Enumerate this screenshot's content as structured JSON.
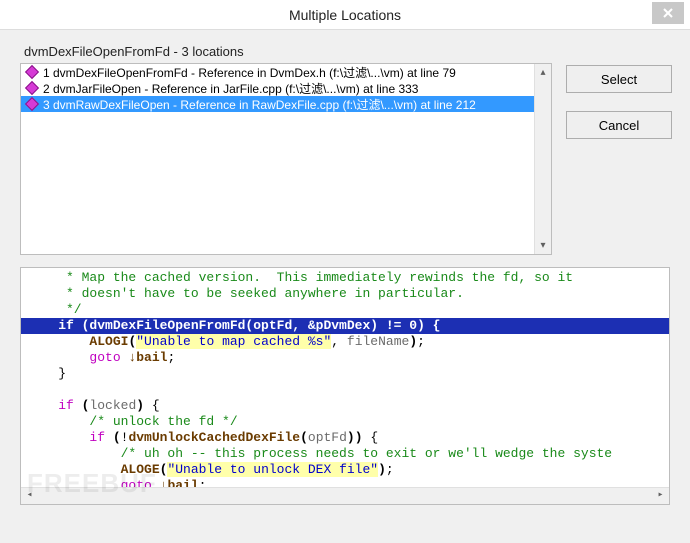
{
  "window": {
    "title": "Multiple Locations",
    "close_glyph": "×"
  },
  "heading": "dvmDexFileOpenFromFd - 3 locations",
  "list": {
    "items": [
      {
        "text": "1 dvmDexFileOpenFromFd - Reference in DvmDex.h (f:\\过滤\\...\\vm) at line 79",
        "selected": false
      },
      {
        "text": "2 dvmJarFileOpen - Reference in JarFile.cpp (f:\\过滤\\...\\vm) at line 333",
        "selected": false
      },
      {
        "text": "3 dvmRawDexFileOpen - Reference in RawDexFile.cpp (f:\\过滤\\...\\vm) at line 212",
        "selected": true
      }
    ]
  },
  "buttons": {
    "select": "Select",
    "cancel": "Cancel"
  },
  "code": {
    "lines": [
      {
        "kind": "comment",
        "text": "     * Map the cached version.  This immediately rewinds the fd, so it"
      },
      {
        "kind": "comment",
        "text": "     * doesn't have to be seeked anywhere in particular."
      },
      {
        "kind": "comment",
        "text": "     */"
      },
      {
        "kind": "hl",
        "text": "    if (dvmDexFileOpenFromFd(optFd, &pDvmDex) != 0) {"
      },
      {
        "kind": "alogi",
        "func": "ALOGI",
        "str": "\"Unable to map cached %s\"",
        "args": "fileName"
      },
      {
        "kind": "goto",
        "label": "bail"
      },
      {
        "kind": "brace",
        "text": "    }"
      },
      {
        "kind": "blank",
        "text": ""
      },
      {
        "kind": "ifplain",
        "text": "locked"
      },
      {
        "kind": "comment2",
        "text": "        /* unlock the fd */"
      },
      {
        "kind": "ifneg",
        "func": "dvmUnlockCachedDexFile",
        "arg": "optFd"
      },
      {
        "kind": "comment3",
        "text": "            /* uh oh -- this process needs to exit or we'll wedge the syste"
      },
      {
        "kind": "aloge",
        "func": "ALOGE",
        "str": "\"Unable to unlock DEX file\""
      },
      {
        "kind": "goto2",
        "label": "bail"
      }
    ]
  },
  "watermark": "FREEBUF"
}
